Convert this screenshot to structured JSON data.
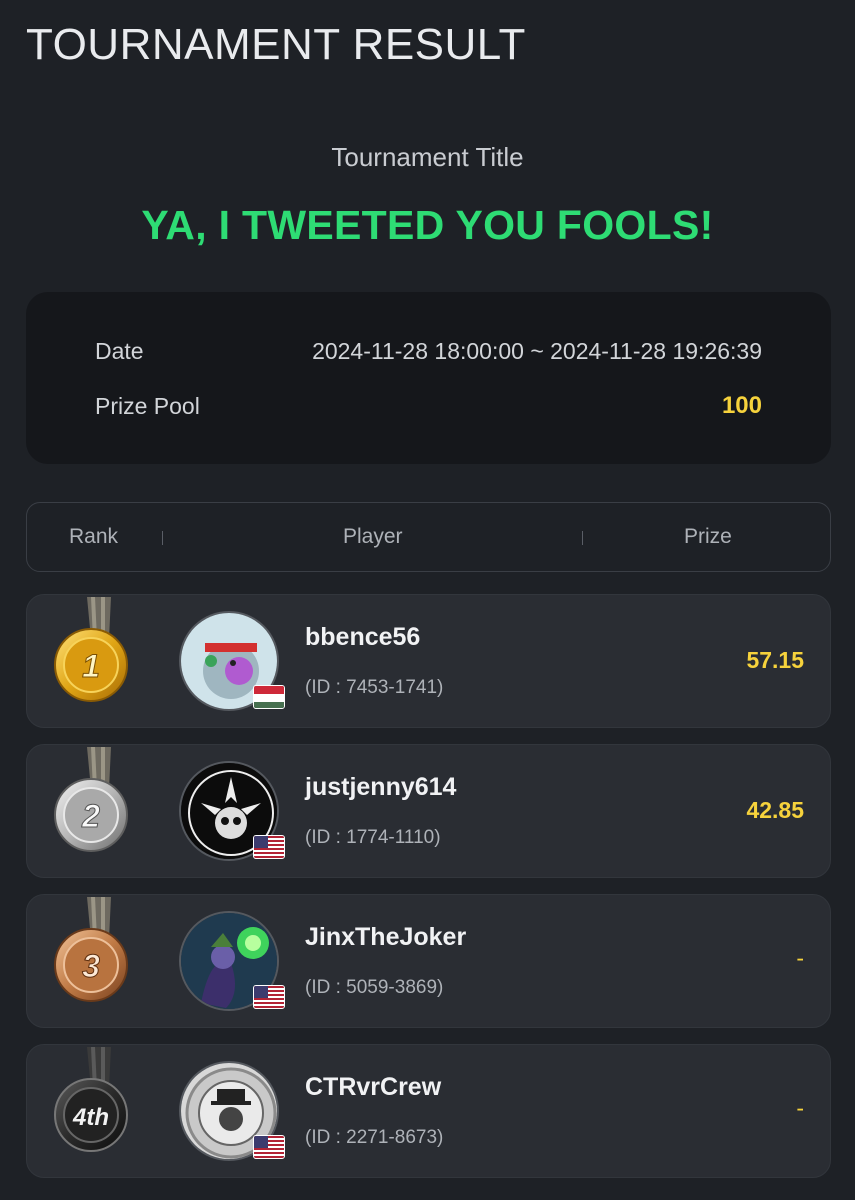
{
  "header": {
    "title": "TOURNAMENT RESULT"
  },
  "tournament": {
    "label": "Tournament Title",
    "name": "YA, I TWEETED YOU FOOLS!"
  },
  "info": {
    "date_label": "Date",
    "date_value": "2024-11-28 18:00:00 ~ 2024-11-28 19:26:39",
    "pool_label": "Prize Pool",
    "pool_value": "100"
  },
  "table": {
    "col_rank": "Rank",
    "col_player": "Player",
    "col_prize": "Prize"
  },
  "players": [
    {
      "rank": "1",
      "medal": "gold-medal-icon",
      "name": "bbence56",
      "id": "(ID : 7453-1741)",
      "prize": "57.15",
      "flag": "hungary-flag-icon"
    },
    {
      "rank": "2",
      "medal": "silver-medal-icon",
      "name": "justjenny614",
      "id": "(ID : 1774-1110)",
      "prize": "42.85",
      "flag": "usa-flag-icon"
    },
    {
      "rank": "3",
      "medal": "bronze-medal-icon",
      "name": "JinxTheJoker",
      "id": "(ID : 5059-3869)",
      "prize": "-",
      "flag": "usa-flag-icon"
    },
    {
      "rank": "4th",
      "medal": "black-medal-icon",
      "name": "CTRvrCrew",
      "id": "(ID : 2271-8673)",
      "prize": "-",
      "flag": "usa-flag-icon"
    }
  ],
  "colors": {
    "background": "#1e2126",
    "accent_green": "#2edc74",
    "prize_yellow": "#f6d23c",
    "card": "#2a2d33"
  }
}
